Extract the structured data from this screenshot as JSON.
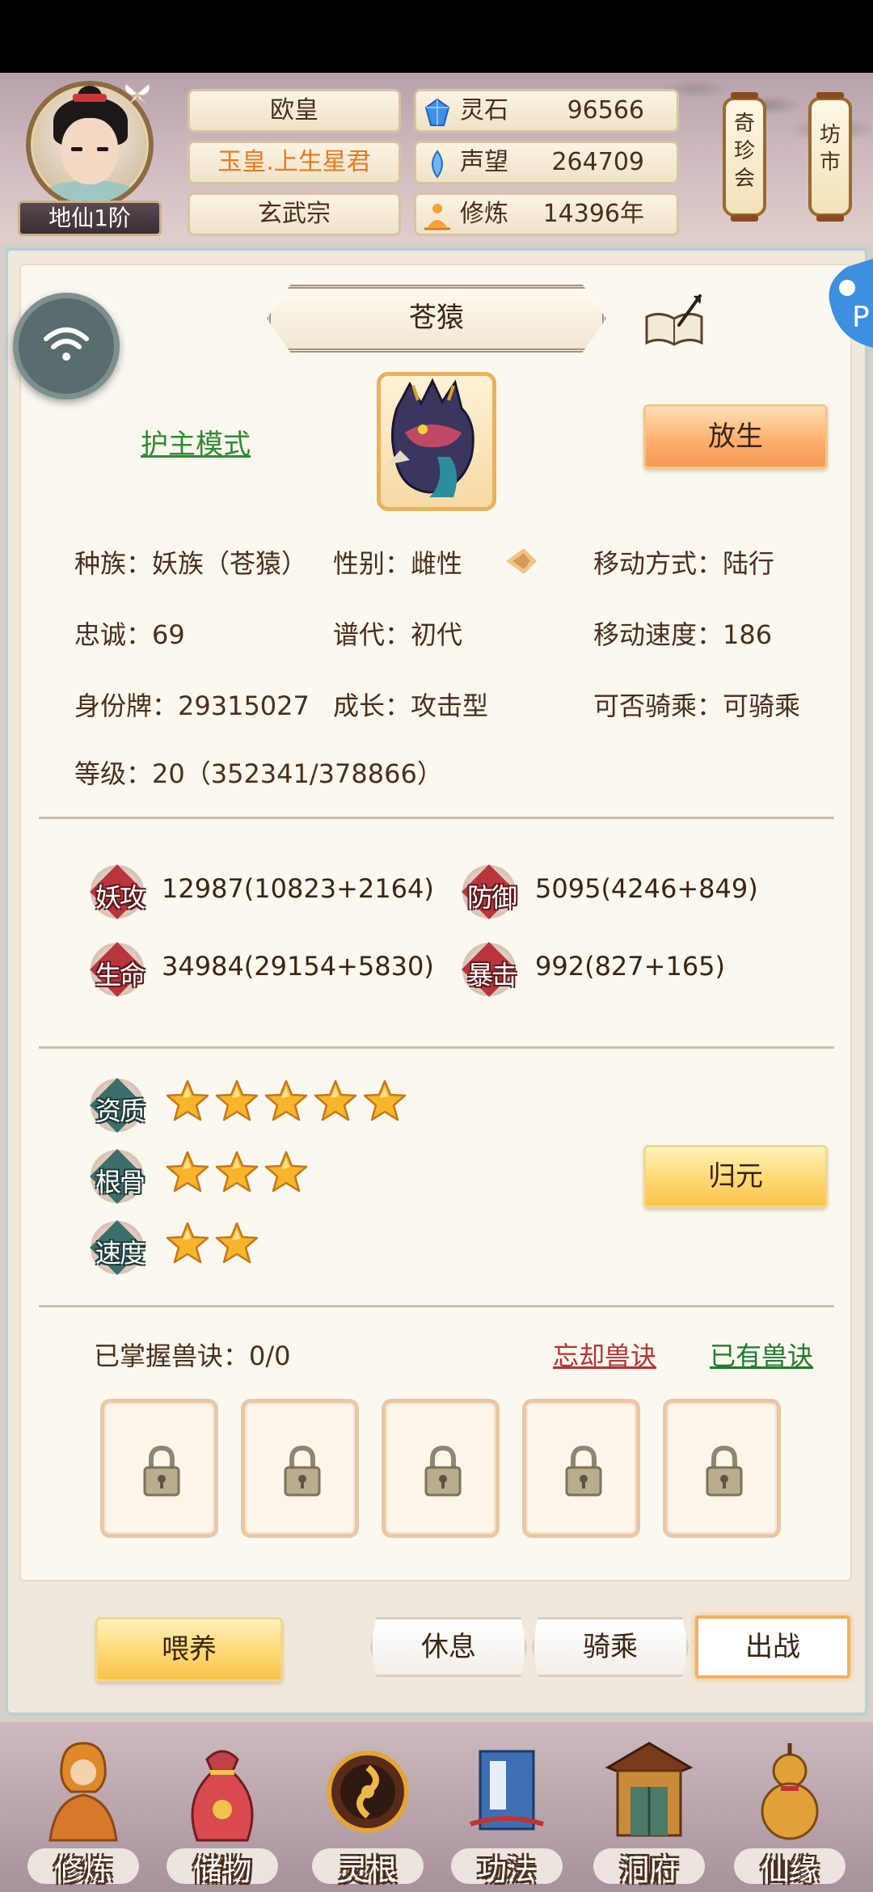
{
  "header": {
    "rank": "地仙1阶",
    "name": "欧皇",
    "title": "玉皇.上生星君",
    "sect": "玄武宗",
    "resources": [
      {
        "icon": "spirit-stone-icon",
        "label": "灵石",
        "value": "96566"
      },
      {
        "icon": "reputation-icon",
        "label": "声望",
        "value": "264709"
      },
      {
        "icon": "cultivation-icon",
        "label": "修炼",
        "value": "14396年"
      }
    ],
    "lanterns": [
      {
        "label": "奇\n珍\n会"
      },
      {
        "label": "坊\n市"
      }
    ]
  },
  "pet": {
    "name": "苍猿",
    "guard_mode": "护主模式",
    "release_label": "放生",
    "attributes": [
      {
        "text": "种族：妖族（苍猿）"
      },
      {
        "text": "性别：雌性"
      },
      {
        "text": "移动方式：陆行"
      },
      {
        "text": "忠诚：69"
      },
      {
        "text": "谱代：初代"
      },
      {
        "text": "移动速度：186"
      },
      {
        "text": "身份牌：29315027"
      },
      {
        "text": "成长：攻击型"
      },
      {
        "text": "可否骑乘：可骑乘"
      },
      {
        "text": "等级：20（352341/378866）"
      }
    ],
    "stats": [
      {
        "badge": "妖攻",
        "value": "12987(10823+2164)"
      },
      {
        "badge": "防御",
        "value": "5095(4246+849)"
      },
      {
        "badge": "生命",
        "value": "34984(29154+5830)"
      },
      {
        "badge": "暴击",
        "value": "992(827+165)"
      }
    ],
    "aptitudes": [
      {
        "badge": "资质",
        "stars": 5
      },
      {
        "badge": "根骨",
        "stars": 3
      },
      {
        "badge": "速度",
        "stars": 2
      }
    ],
    "revert_label": "归元",
    "skills_label": "已掌握兽诀：0/0",
    "forget_label": "忘却兽诀",
    "owned_label": "已有兽诀",
    "slots": [
      "locked",
      "locked",
      "locked",
      "locked",
      "locked"
    ]
  },
  "actions": {
    "feed": "喂养",
    "rest": "休息",
    "ride": "骑乘",
    "battle": "出战"
  },
  "nav": [
    {
      "label": "修炼",
      "icon": "meditating-monk-icon"
    },
    {
      "label": "储物",
      "icon": "storage-bag-icon"
    },
    {
      "label": "灵根",
      "icon": "spirit-root-icon"
    },
    {
      "label": "功法",
      "icon": "technique-book-icon"
    },
    {
      "label": "洞府",
      "icon": "cave-mansion-icon"
    },
    {
      "label": "仙缘",
      "icon": "gourd-icon"
    }
  ],
  "colors": {
    "accent_orange": "#f39a52",
    "accent_gold": "#f7c34a",
    "title_orange": "#e87a1e",
    "link_green": "#1f7d2c",
    "link_red": "#b83232"
  }
}
